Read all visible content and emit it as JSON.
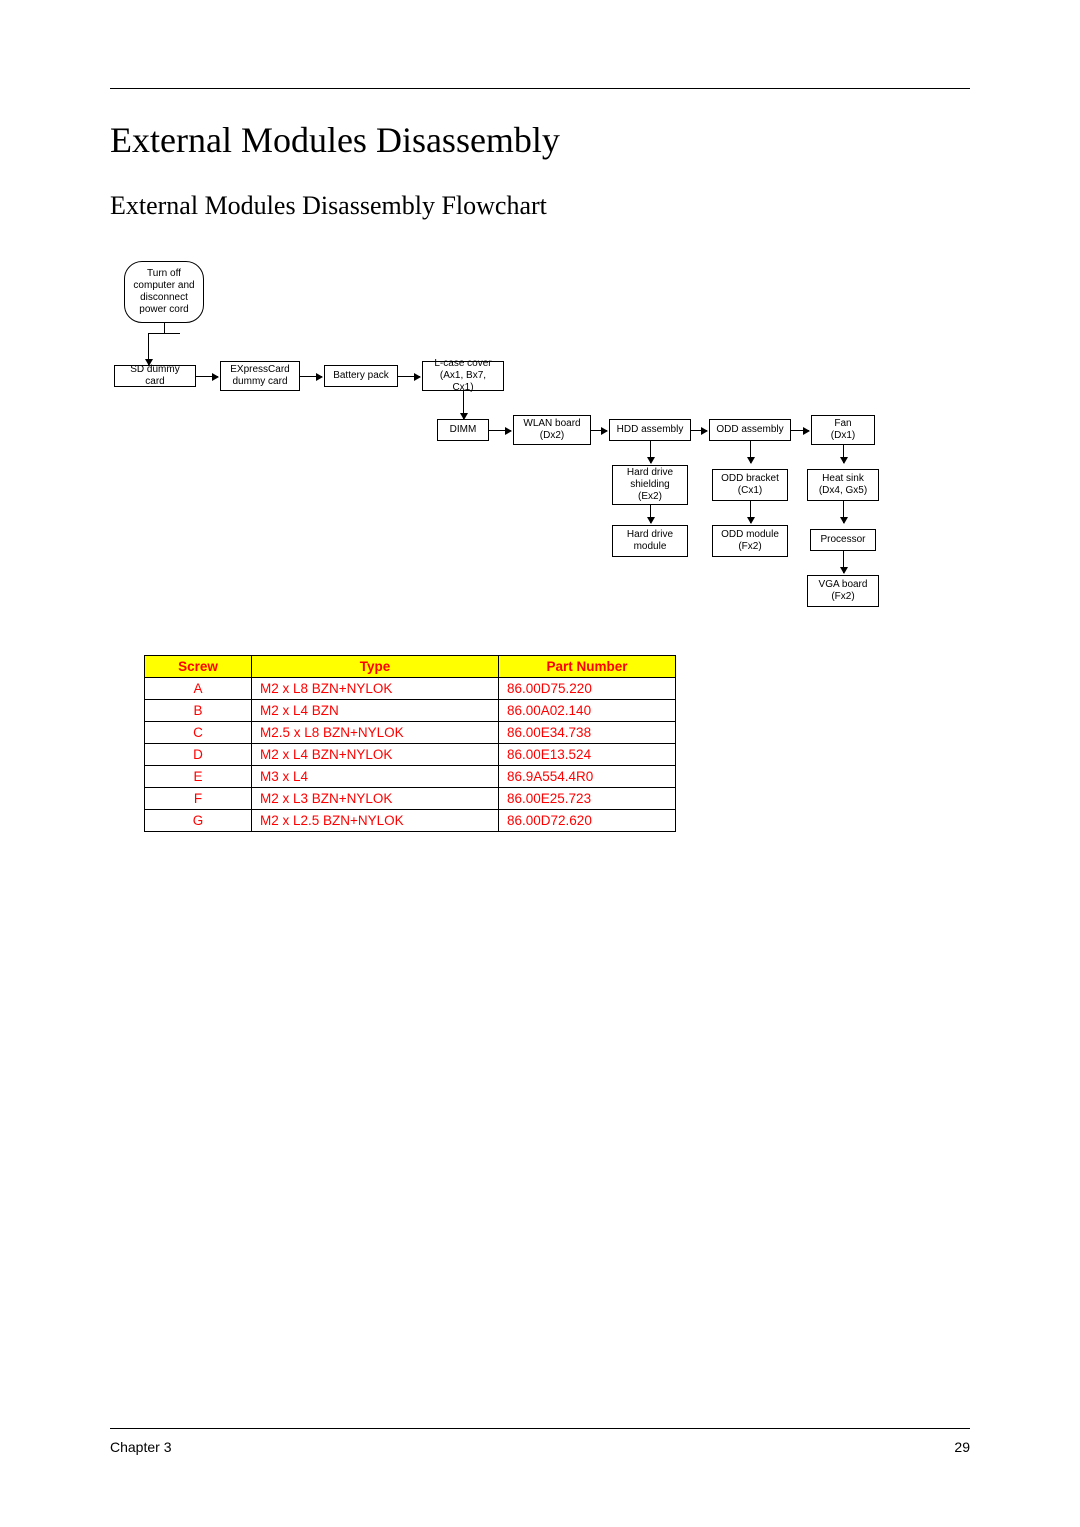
{
  "heading_main": "External Modules Disassembly",
  "heading_sub": "External Modules Disassembly Flowchart",
  "nodes": {
    "start": {
      "l1": "Turn off",
      "l2": "computer and",
      "l3": "disconnect",
      "l4": "power cord"
    },
    "sd": "SD dummy card",
    "expc": {
      "l1": "EXpressCard",
      "l2": "dummy card"
    },
    "batt": "Battery pack",
    "lcase": {
      "l1": "L-case cover",
      "l2": "(Ax1, Bx7, Cx1)"
    },
    "dimm": "DIMM",
    "wlan": {
      "l1": "WLAN board",
      "l2": "(Dx2)"
    },
    "hdda": "HDD assembly",
    "odda": "ODD assembly",
    "fan": {
      "l1": "Fan",
      "l2": "(Dx1)"
    },
    "hddsh": {
      "l1": "Hard drive",
      "l2": "shielding",
      "l3": "(Ex2)"
    },
    "oddbr": {
      "l1": "ODD bracket",
      "l2": "(Cx1)"
    },
    "heats": {
      "l1": "Heat sink",
      "l2": "(Dx4, Gx5)"
    },
    "hddm": {
      "l1": "Hard drive",
      "l2": "module"
    },
    "oddm": {
      "l1": "ODD module",
      "l2": "(Fx2)"
    },
    "proc": "Processor",
    "vga": {
      "l1": "VGA board",
      "l2": "(Fx2)"
    }
  },
  "screw_headers": {
    "c1": "Screw",
    "c2": "Type",
    "c3": "Part Number"
  },
  "screws": [
    {
      "s": "A",
      "t": "M2 x L8 BZN+NYLOK",
      "p": "86.00D75.220"
    },
    {
      "s": "B",
      "t": "M2 x L4 BZN",
      "p": "86.00A02.140"
    },
    {
      "s": "C",
      "t": "M2.5 x L8 BZN+NYLOK",
      "p": "86.00E34.738"
    },
    {
      "s": "D",
      "t": "M2 x L4 BZN+NYLOK",
      "p": "86.00E13.524"
    },
    {
      "s": "E",
      "t": "M3 x L4",
      "p": "86.9A554.4R0"
    },
    {
      "s": "F",
      "t": "M2 x L3 BZN+NYLOK",
      "p": "86.00E25.723"
    },
    {
      "s": "G",
      "t": "M2 x L2.5 BZN+NYLOK",
      "p": "86.00D72.620"
    }
  ],
  "footer": {
    "left": "Chapter 3",
    "right": "29"
  }
}
